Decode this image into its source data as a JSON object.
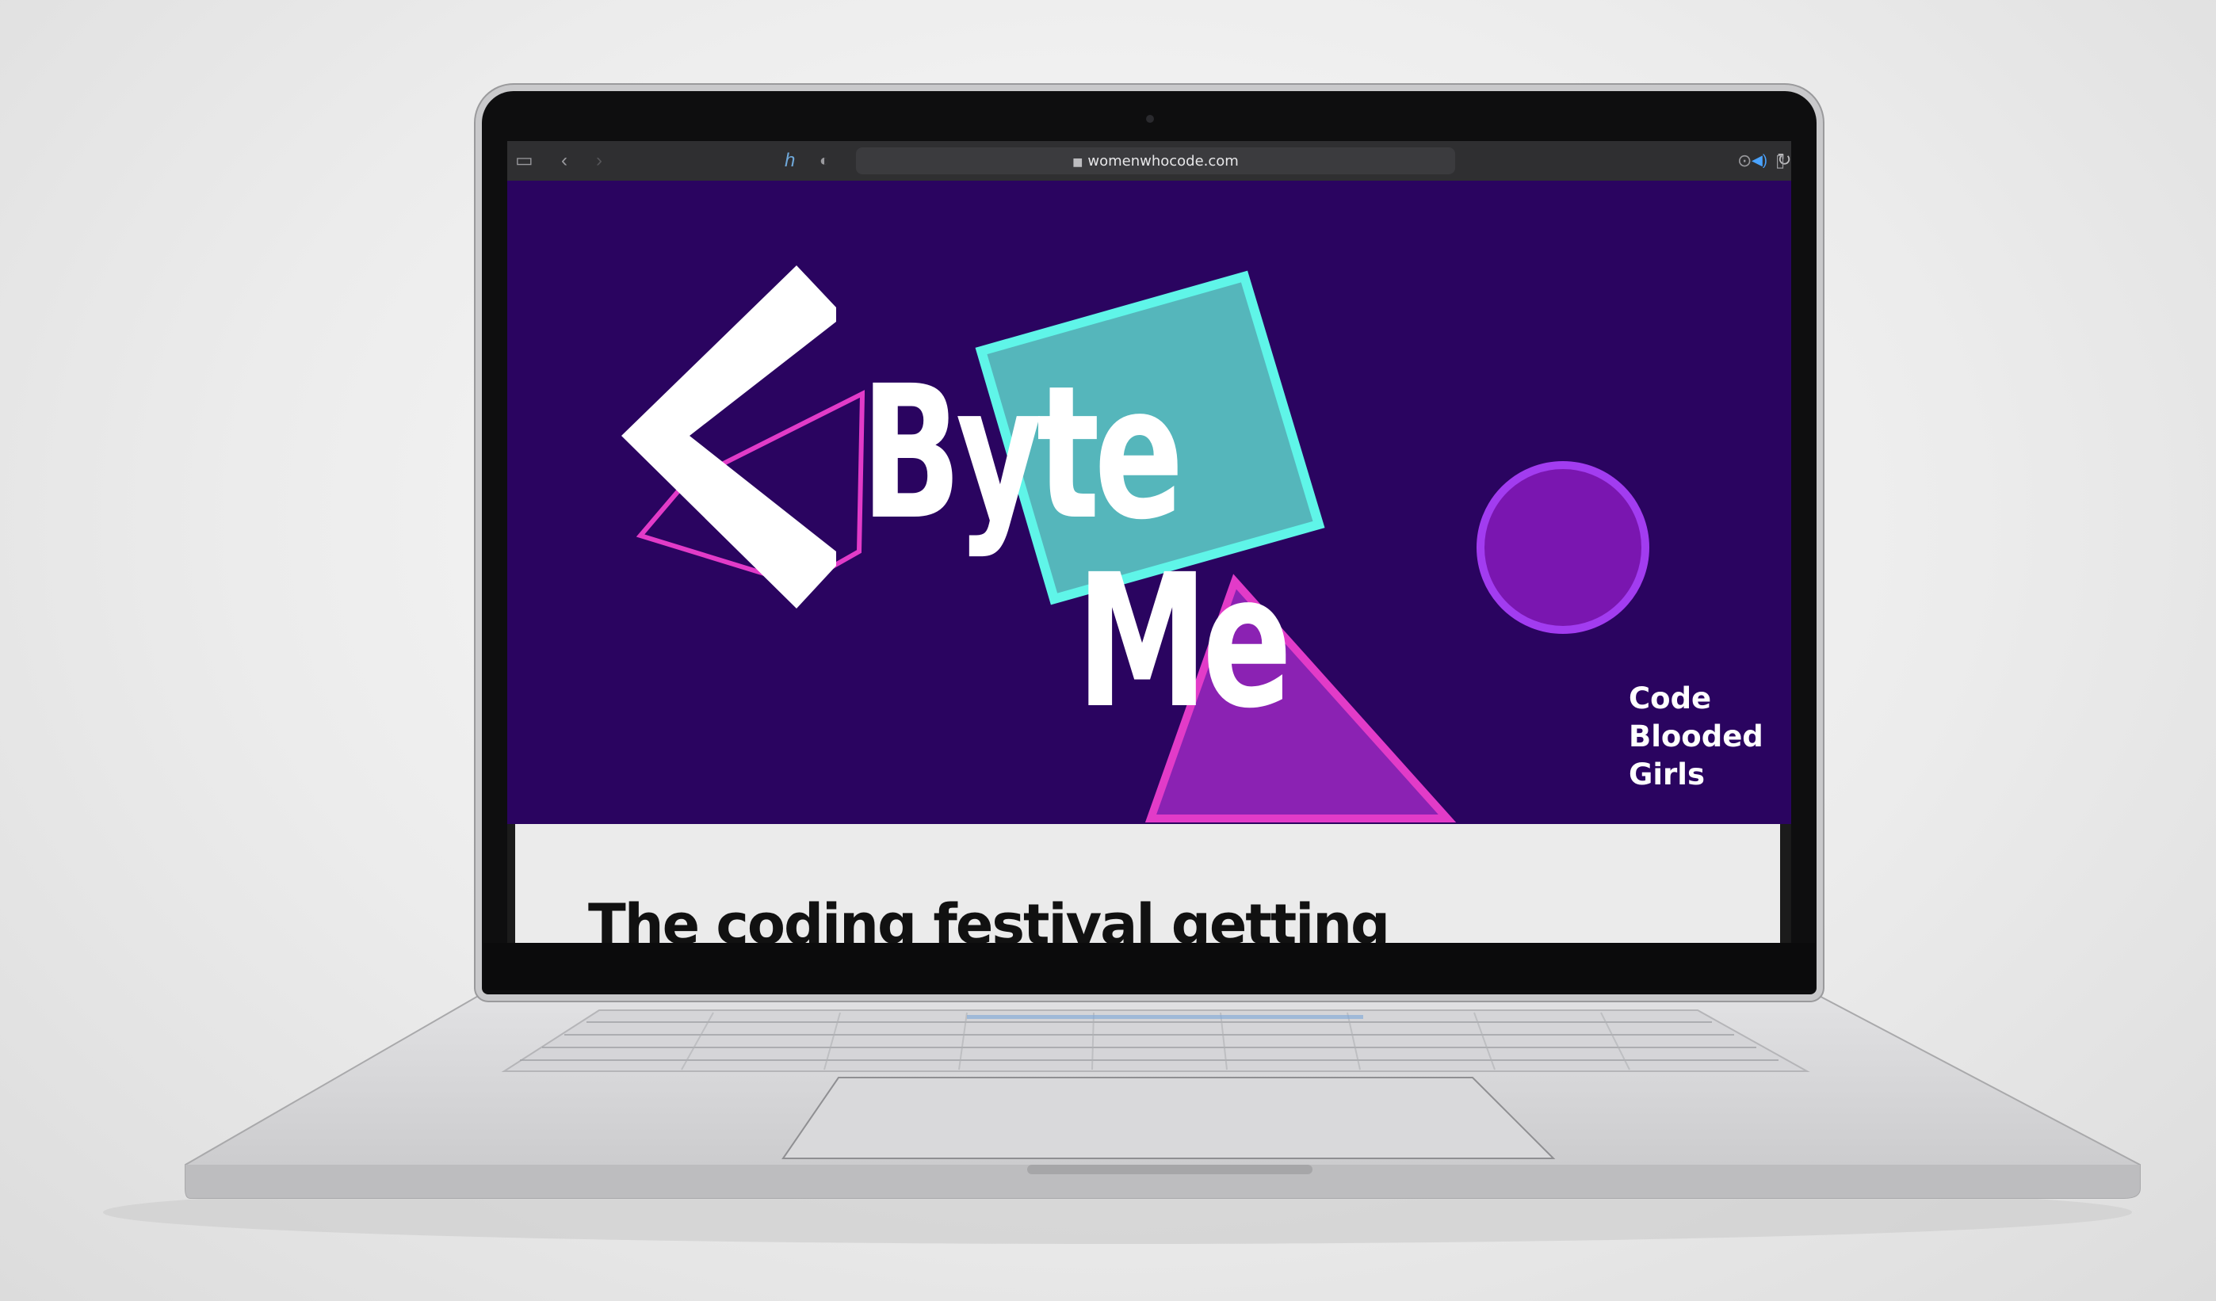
{
  "browser": {
    "url": "womenwhocode.com",
    "icons": [
      "sidebar-icon",
      "back-icon",
      "forward-icon",
      "honey-extension-icon",
      "privacy-shield-icon",
      "lock-icon",
      "audio-icon",
      "reload-icon",
      "download-icon",
      "share-icon"
    ]
  },
  "hero": {
    "title_line1": "Byte",
    "title_line2": "Me",
    "tagline": [
      "Code",
      "Blooded",
      "Girls"
    ],
    "colors": {
      "background": "#2a0460",
      "teal": "#55b6bb",
      "teal_outline": "#5ff5e8",
      "magenta": "#e23bc8",
      "purple_fill": "#8b22b3",
      "violet_circle": "#7a16b0",
      "violet_outline": "#a23cf0",
      "white": "#ffffff"
    }
  },
  "content": {
    "headline": "The coding festival getting"
  }
}
